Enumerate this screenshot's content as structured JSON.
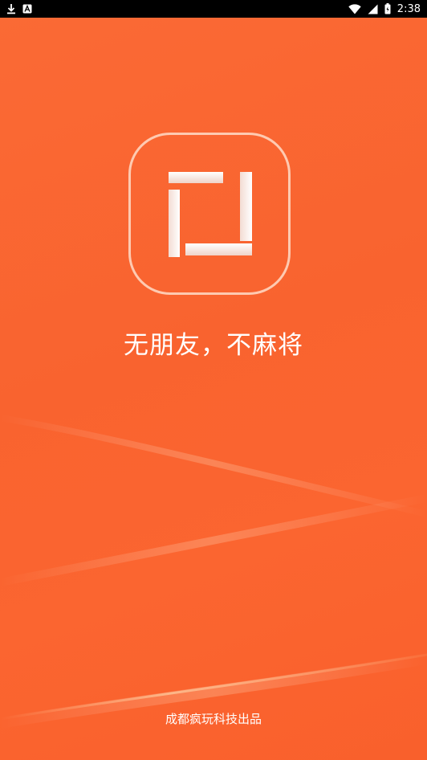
{
  "status_bar": {
    "time": "2:38",
    "left_icons": [
      "download-icon",
      "a-badge-icon"
    ],
    "right_icons": [
      "wifi-icon",
      "cell-signal-icon",
      "battery-icon"
    ]
  },
  "splash": {
    "slogan": "无朋友，不麻将",
    "footer": "成都疯玩科技出品",
    "background_color": "#f9632f",
    "logo_color": "#ffffff"
  }
}
